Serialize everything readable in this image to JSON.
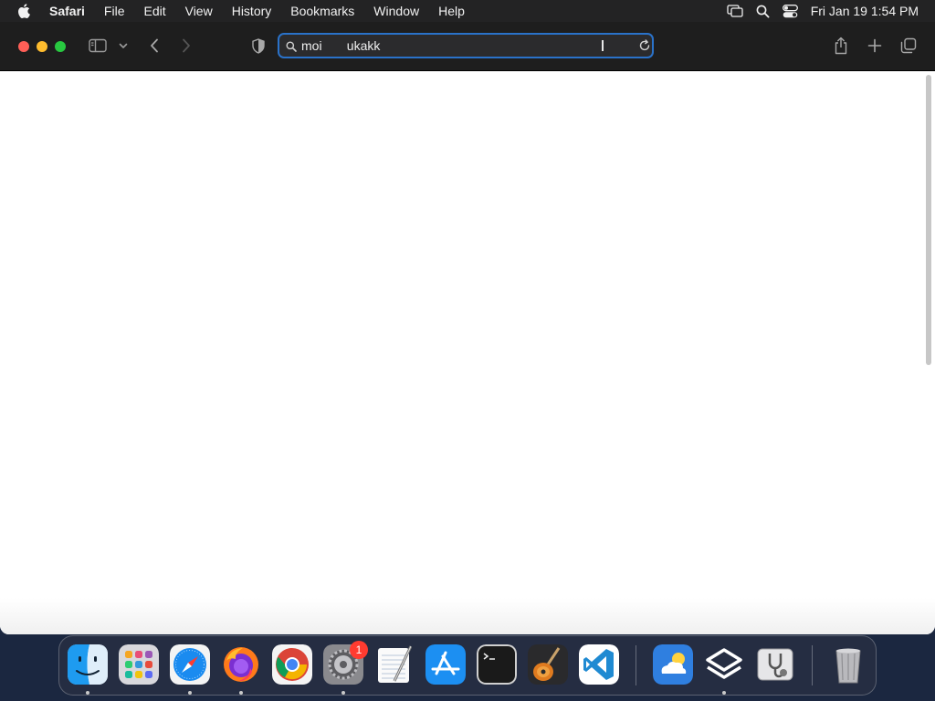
{
  "menubar": {
    "app_name": "Safari",
    "items": [
      "File",
      "Edit",
      "View",
      "History",
      "Bookmarks",
      "Window",
      "Help"
    ],
    "clock": "Fri Jan 19  1:54 PM",
    "status_icons": [
      "screen-mirroring-icon",
      "spotlight-search-icon",
      "control-center-icon"
    ]
  },
  "toolbar": {
    "address_text": "moi       ukakk",
    "buttons": [
      "sidebar-toggle",
      "tab-group-menu",
      "back",
      "forward",
      "privacy-shield",
      "share",
      "new-tab",
      "tab-overview"
    ]
  },
  "dock": {
    "apps": [
      "Finder",
      "Launchpad",
      "Safari",
      "Firefox",
      "Google Chrome",
      "System Settings",
      "TextEdit",
      "App Store",
      "Terminal",
      "GarageBand",
      "Visual Studio Code",
      "Weather",
      "Layers App",
      "Disk Utility",
      "Trash"
    ],
    "settings_badge": "1"
  },
  "colors": {
    "menubar_bg": "#232324",
    "toolbar_bg": "#1e1e1e",
    "url_focus_ring": "#2a72c9",
    "close": "#fe5f57",
    "minimize": "#febc2e",
    "zoom": "#28c840",
    "badge": "#ff3b30"
  }
}
